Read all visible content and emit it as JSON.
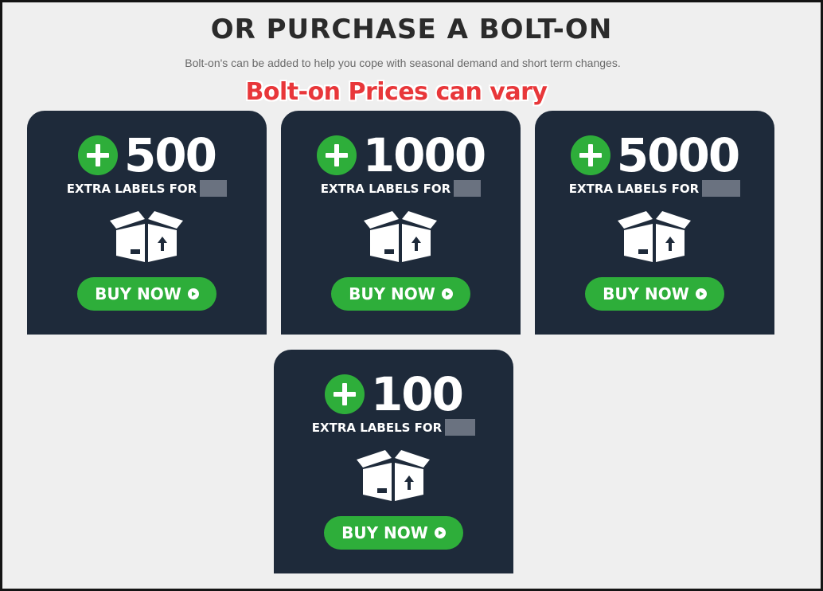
{
  "header": {
    "title": "OR PURCHASE A BOLT-ON",
    "subtitle": "Bolt-on's can be added to help you cope with seasonal demand and short term changes.",
    "annotation": "Bolt-on Prices can vary"
  },
  "colors": {
    "card_background": "#1e2a3a",
    "accent_green": "#2eae3a",
    "annotation_red": "#e8373a",
    "page_background": "#efefef"
  },
  "cards": [
    {
      "amount": "500",
      "extra_label": "EXTRA LABELS FOR",
      "button_label": "BUY NOW",
      "icon": "open-box-icon"
    },
    {
      "amount": "1000",
      "extra_label": "EXTRA LABELS FOR",
      "button_label": "BUY NOW",
      "icon": "open-box-icon"
    },
    {
      "amount": "5000",
      "extra_label": "EXTRA LABELS FOR",
      "button_label": "BUY NOW",
      "icon": "open-box-icon"
    },
    {
      "amount": "100",
      "extra_label": "EXTRA LABELS FOR",
      "button_label": "BUY NOW",
      "icon": "open-box-icon"
    }
  ]
}
